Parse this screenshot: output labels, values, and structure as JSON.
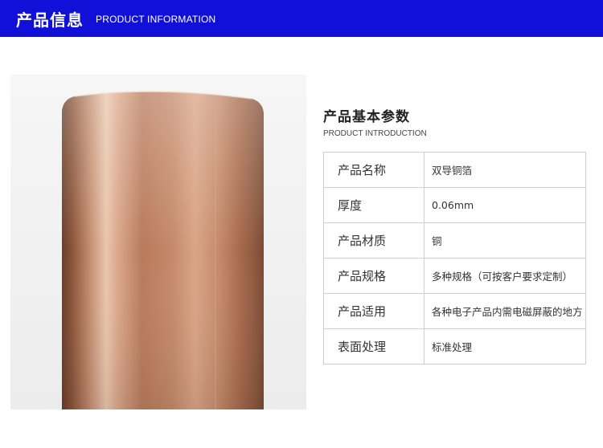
{
  "header": {
    "title": "产品信息",
    "subtitle": "PRODUCT INFORMATION",
    "color": "#1010d8"
  },
  "section": {
    "title": "产品基本参数",
    "subtitle": "PRODUCT INTRODUCTION"
  },
  "specs": [
    {
      "label": "产品名称",
      "value": "双导铜箔"
    },
    {
      "label": "厚度",
      "value": "0.06mm"
    },
    {
      "label": "产品材质",
      "value": "铜"
    },
    {
      "label": "产品规格",
      "value": "多种规格（可按客户要求定制）"
    },
    {
      "label": "产品适用",
      "value": "各种电子产品内需电磁屏蔽的地方"
    },
    {
      "label": "表面处理",
      "value": "标准处理"
    }
  ]
}
